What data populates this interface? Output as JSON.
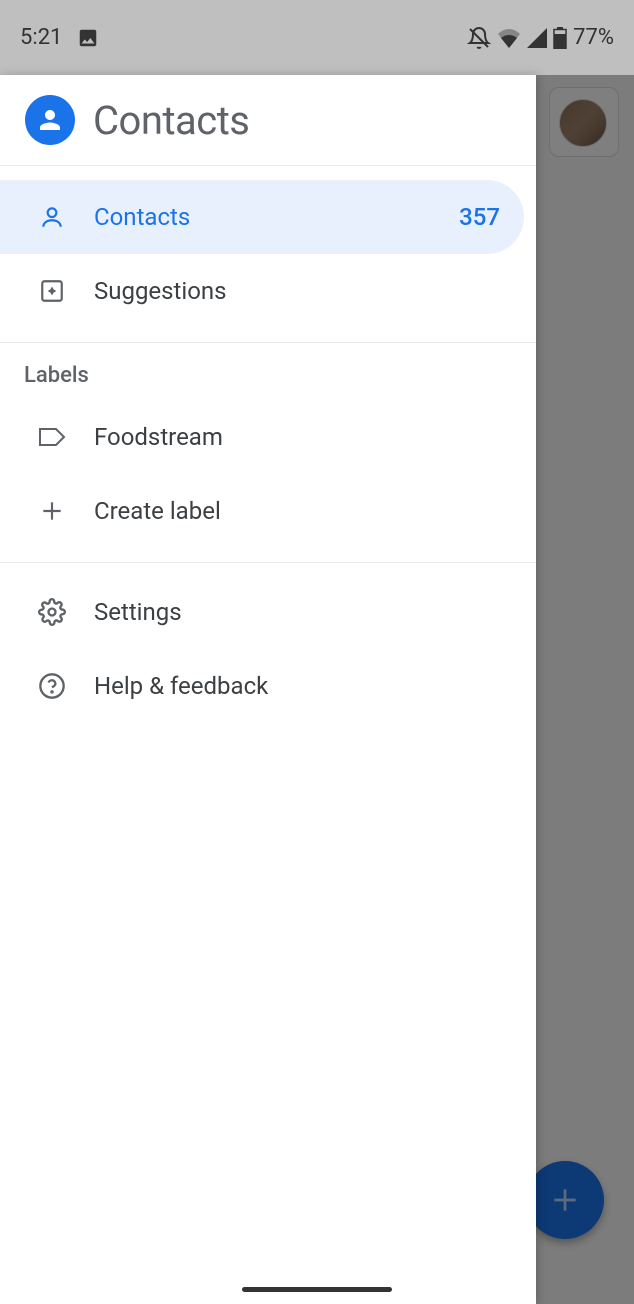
{
  "status": {
    "time": "5:21",
    "battery": "77%"
  },
  "drawer": {
    "title": "Contacts",
    "items": [
      {
        "label": "Contacts",
        "count": "357",
        "icon": "person-icon"
      },
      {
        "label": "Suggestions",
        "icon": "sparkle-box-icon"
      }
    ],
    "labels_header": "Labels",
    "labels": [
      {
        "label": "Foodstream",
        "icon": "label-icon"
      }
    ],
    "create_label": "Create label",
    "settings": "Settings",
    "help": "Help & feedback"
  },
  "fab_icon": "plus-icon"
}
